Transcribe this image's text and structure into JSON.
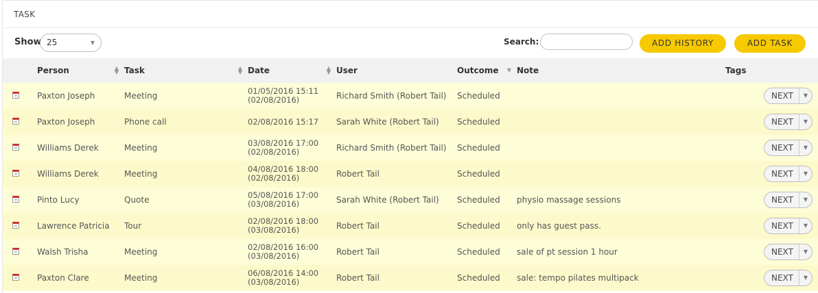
{
  "panel": {
    "title": "TASK"
  },
  "toolbar": {
    "show_label": "Show",
    "show_value": "25",
    "search_label": "Search:",
    "search_value": "",
    "add_history_label": "ADD HISTORY",
    "add_task_label": "ADD TASK"
  },
  "columns": {
    "person": "Person",
    "task": "Task",
    "date": "Date",
    "user": "User",
    "outcome": "Outcome",
    "note": "Note",
    "tags": "Tags"
  },
  "rows": [
    {
      "person": "Paxton Joseph",
      "task": "Meeting",
      "date": "01/05/2016 15:11",
      "date2": "(02/08/2016)",
      "user": "Richard Smith (Robert Tail)",
      "outcome": "Scheduled",
      "note": "",
      "action": "NEXT"
    },
    {
      "person": "Paxton Joseph",
      "task": "Phone call",
      "date": "02/08/2016 15:17",
      "date2": "",
      "user": "Sarah White (Robert Tail)",
      "outcome": "Scheduled",
      "note": "",
      "action": "NEXT"
    },
    {
      "person": "Williams Derek",
      "task": "Meeting",
      "date": "03/08/2016 17:00",
      "date2": "(02/08/2016)",
      "user": "Richard Smith (Robert Tail)",
      "outcome": "Scheduled",
      "note": "",
      "action": "NEXT"
    },
    {
      "person": "Williams Derek",
      "task": "Meeting",
      "date": "04/08/2016 18:00",
      "date2": "(02/08/2016)",
      "user": "Robert Tail",
      "outcome": "Scheduled",
      "note": "",
      "action": "NEXT"
    },
    {
      "person": "Pinto Lucy",
      "task": "Quote",
      "date": "05/08/2016 17:00",
      "date2": "(03/08/2016)",
      "user": "Sarah White (Robert Tail)",
      "outcome": "Scheduled",
      "note": "physio massage sessions",
      "action": "NEXT"
    },
    {
      "person": "Lawrence Patricia",
      "task": "Tour",
      "date": "02/08/2016 18:00",
      "date2": "(03/08/2016)",
      "user": "Robert Tail",
      "outcome": "Scheduled",
      "note": "only has guest pass.",
      "action": "NEXT"
    },
    {
      "person": "Walsh Trisha",
      "task": "Meeting",
      "date": "02/08/2016 16:00",
      "date2": "(03/08/2016)",
      "user": "Robert Tail",
      "outcome": "Scheduled",
      "note": "sale of pt session 1 hour",
      "action": "NEXT"
    },
    {
      "person": "Paxton Clare",
      "task": "Meeting",
      "date": "06/08/2016 14:00",
      "date2": "(03/08/2016)",
      "user": "Robert Tail",
      "outcome": "Scheduled",
      "note": "sale: tempo pilates multipack",
      "action": "NEXT"
    }
  ],
  "colors": {
    "accent": "#f7c900",
    "row_odd": "#fdfdd8",
    "row_even": "#fcfacb",
    "header_bg": "#f1f1f1"
  },
  "icons": {
    "row_icon": "calendar-icon",
    "sort": "sort-arrows-icon",
    "dropdown": "chevron-down-icon"
  }
}
